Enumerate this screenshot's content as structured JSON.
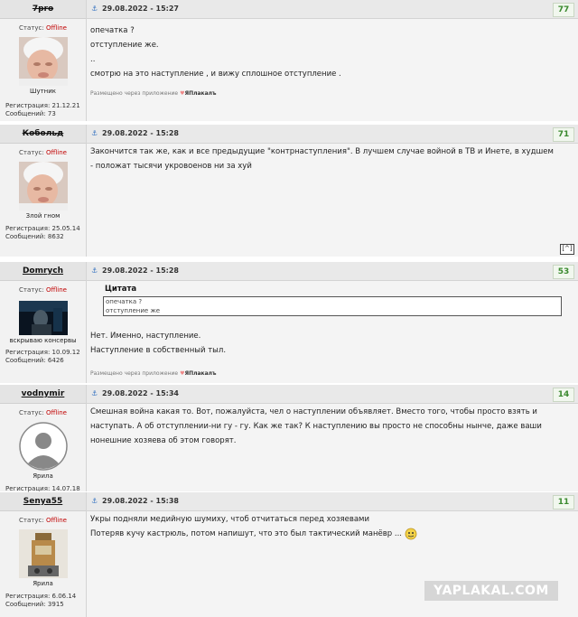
{
  "posts": [
    {
      "nick": "7pro",
      "strike": true,
      "status_label": "Статус:",
      "status_value": "Offline",
      "rank": "Шутник",
      "reg": "Регистрация: 21.12.21",
      "msgs": "Сообщений: 73",
      "date": "29.08.2022 - 15:27",
      "number": "77",
      "lines": [
        "опечатка ?",
        "отступление же.",
        "..",
        "смотрю на это наступление , и вижу сплошное отступление ."
      ],
      "via_prefix": "Размещено через приложение",
      "via_app": "ЯПлакалъ",
      "avatar": "baby"
    },
    {
      "nick": "Кобольд",
      "strike": true,
      "status_label": "Статус:",
      "status_value": "Offline",
      "rank": "Злой гном",
      "reg": "Регистрация: 25.05.14",
      "msgs": "Сообщений: 8632",
      "date": "29.08.2022 - 15:28",
      "number": "71",
      "lines": [
        "Закончится так же, как и все предыдущие \"контрнаступления\". В лучшем случае войной в ТВ и Инете, в худшем",
        "- положат тысячи укровоенов ни за хуй"
      ],
      "totop": "[^]",
      "avatar": "baby"
    },
    {
      "nick": "Domrych",
      "strike": false,
      "status_label": "Статус:",
      "status_value": "Offline",
      "rank": "вскрываю консервы",
      "reg": "Регистрация: 10.09.12",
      "msgs": "Сообщений: 6426",
      "date": "29.08.2022 - 15:28",
      "number": "53",
      "quote_label": "Цитата",
      "quote_lines": [
        "опечатка ?",
        "отступление же"
      ],
      "lines": [
        "Нет. Именно, наступление.",
        "Наступление в собственный тыл."
      ],
      "via_prefix": "Размещено через приложение",
      "via_app": "ЯПлакалъ",
      "avatar": "dark"
    },
    {
      "nick": "vodnymir",
      "strike": false,
      "status_label": "Статус:",
      "status_value": "Offline",
      "rank": "Ярила",
      "reg": "Регистрация: 14.07.18",
      "date": "29.08.2022 - 15:34",
      "number": "14",
      "lines": [
        "Смешная война какая то. Вот, пожалуйста, чел о наступлении объявляет. Вместо того, чтобы просто взять и",
        "наступать. А об отступлении-ни гу - гу. Как же так? К наступлению вы просто не способны нынче, даже ваши",
        "нонешние хозяева об этом говорят."
      ],
      "avatar": "silhouette"
    },
    {
      "nick": "Senya55",
      "strike": false,
      "status_label": "Статус:",
      "status_value": "Offline",
      "rank": "Ярила",
      "reg": "Регистрация: 6.06.14",
      "msgs": "Сообщений: 3915",
      "date": "29.08.2022 - 15:38",
      "number": "11",
      "lines": [
        "Укры подняли медийную шумиху, чтоб отчитаться перед хозяевами",
        "Потеряв кучу кастрюль, потом напишут, что это был тактический манёвр ..."
      ],
      "avatar": "bottle"
    }
  ],
  "watermark": "YAPLAKAL.COM",
  "icons": {
    "anchor": "anchor-icon",
    "smiley": "smiley-icon"
  },
  "colors": {
    "offline": "#c00000",
    "number": "#3b8a2f",
    "anchor": "#3a76c2"
  }
}
